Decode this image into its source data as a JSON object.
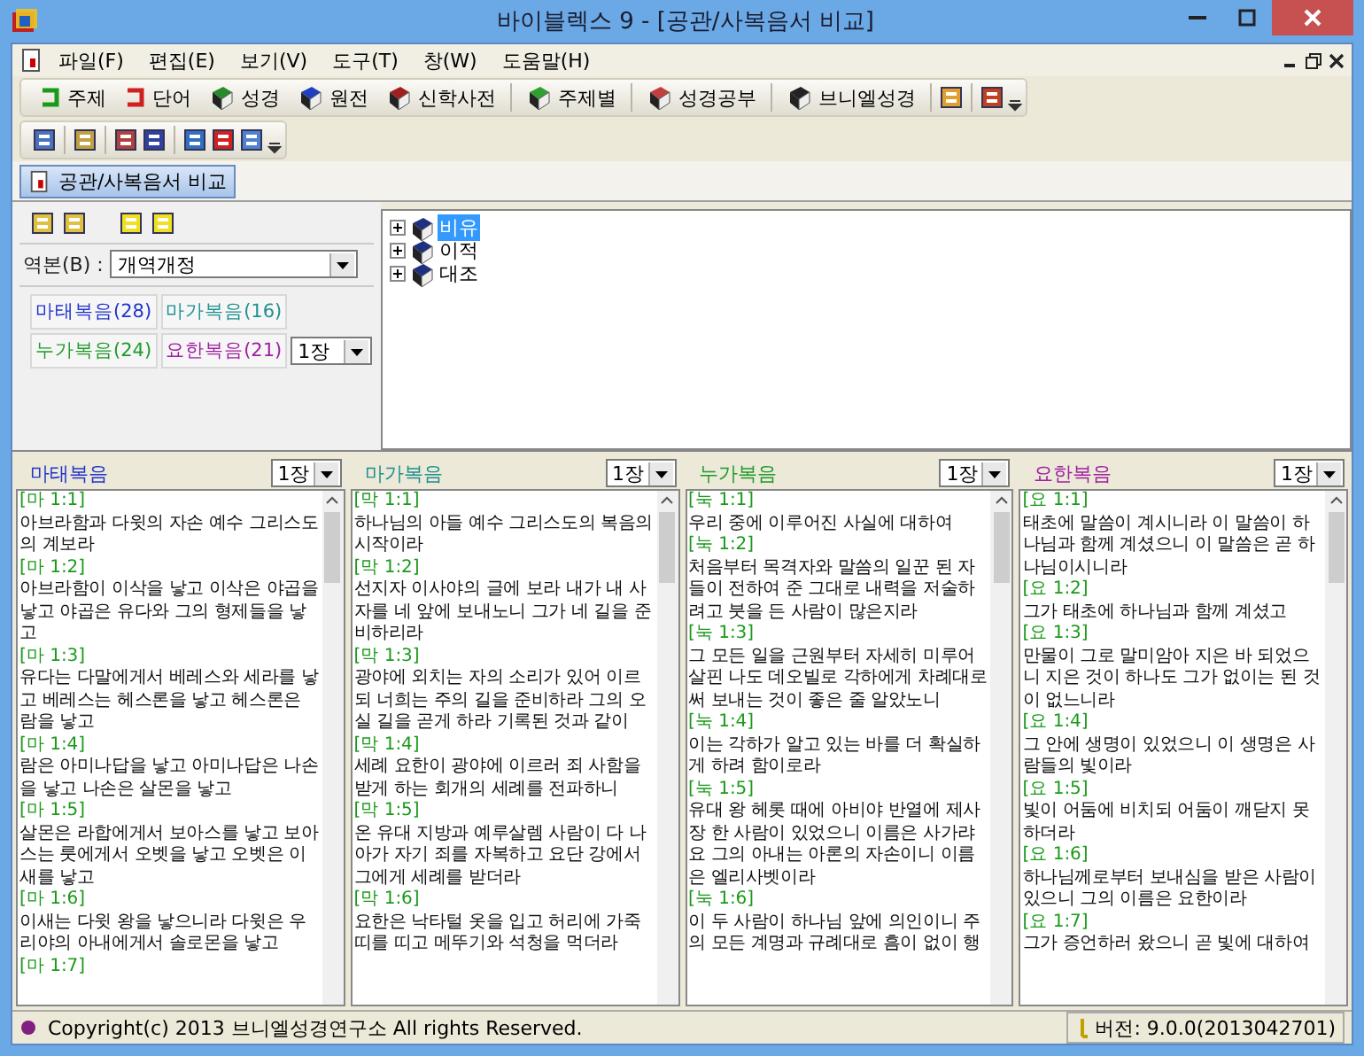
{
  "window": {
    "title": "바이블렉스 9 - [공관/사복음서 비교]"
  },
  "menu": [
    "파일(F)",
    "편집(E)",
    "보기(V)",
    "도구(T)",
    "창(W)",
    "도움말(H)"
  ],
  "toolbar": [
    {
      "label": "주제"
    },
    {
      "label": "단어"
    },
    {
      "label": "성경"
    },
    {
      "label": "원전"
    },
    {
      "label": "신학사전"
    },
    {
      "label": "주제별"
    },
    {
      "label": "성경공부"
    },
    {
      "label": "브니엘성경"
    }
  ],
  "document_tab": {
    "label": "공관/사복음서 비교",
    "selected": true
  },
  "version": {
    "label": "역본(B) :",
    "value": "개역개정"
  },
  "gospel_tabs": [
    {
      "label": "마태복음(28)",
      "color": "#2233cc"
    },
    {
      "label": "마가복음(16)",
      "color": "#1f8f8f"
    },
    {
      "label": "누가복음(24)",
      "color": "#1f9a2a"
    },
    {
      "label": "요한복음(21)",
      "color": "#a020a0"
    }
  ],
  "chapter": "1장",
  "tree": [
    {
      "label": "비유",
      "selected": true
    },
    {
      "label": "이적",
      "selected": false
    },
    {
      "label": "대조",
      "selected": false
    }
  ],
  "columns": [
    {
      "title": "마태복음",
      "color": "#2233cc",
      "chapter": "1장",
      "verses": [
        {
          "ref": "[마 1:1]",
          "text": "아브라함과 다윗의 자손 예수 그리스도의 계보라"
        },
        {
          "ref": "[마 1:2]",
          "text": "아브라함이 이삭을 낳고 이삭은 야곱을 낳고 야곱은 유다와 그의 형제들을 낳고"
        },
        {
          "ref": "[마 1:3]",
          "text": "유다는 다말에게서 베레스와 세라를 낳고 베레스는 헤스론을 낳고 헤스론은 람을 낳고"
        },
        {
          "ref": "[마 1:4]",
          "text": "람은 아미나답을 낳고 아미나답은 나손을 낳고 나손은 살몬을 낳고"
        },
        {
          "ref": "[마 1:5]",
          "text": "살몬은 라합에게서 보아스를 낳고 보아스는 룻에게서 오벳을 낳고 오벳은 이새를 낳고"
        },
        {
          "ref": "[마 1:6]",
          "text": "이새는 다윗 왕을 낳으니라 다윗은 우리야의 아내에게서 솔로몬을 낳고"
        },
        {
          "ref": "[마 1:7]"
        }
      ]
    },
    {
      "title": "마가복음",
      "color": "#1f8f8f",
      "chapter": "1장",
      "verses": [
        {
          "ref": "[막 1:1]",
          "text": "하나님의 아들 예수 그리스도의 복음의 시작이라"
        },
        {
          "ref": "[막 1:2]",
          "text": "선지자 이사야의 글에 보라 내가 내 사자를 네 앞에 보내노니 그가 네 길을 준비하리라"
        },
        {
          "ref": "[막 1:3]",
          "text": "광야에 외치는 자의 소리가 있어 이르되 너희는 주의 길을 준비하라 그의 오실 길을 곧게 하라 기록된 것과 같이"
        },
        {
          "ref": "[막 1:4]",
          "text": "세례 요한이 광야에 이르러 죄 사함을 받게 하는 회개의 세례를 전파하니"
        },
        {
          "ref": "[막 1:5]",
          "text": "온 유대 지방과 예루살렘 사람이 다 나아가 자기 죄를 자복하고 요단 강에서 그에게 세례를 받더라"
        },
        {
          "ref": "[막 1:6]",
          "text": "요한은 낙타털 옷을 입고 허리에 가죽 띠를 띠고 메뚜기와 석청을 먹더라"
        }
      ]
    },
    {
      "title": "누가복음",
      "color": "#1f9a2a",
      "chapter": "1장",
      "verses": [
        {
          "ref": "[눅 1:1]",
          "text": "우리 중에 이루어진 사실에 대하여"
        },
        {
          "ref": "[눅 1:2]",
          "text": "처음부터 목격자와 말씀의 일꾼 된 자들이 전하여 준 그대로 내력을 저술하려고 붓을 든 사람이 많은지라"
        },
        {
          "ref": "[눅 1:3]",
          "text": "그 모든 일을 근원부터 자세히 미루어 살핀 나도 데오빌로 각하에게 차례대로 써 보내는 것이 좋은 줄 알았노니"
        },
        {
          "ref": "[눅 1:4]",
          "text": "이는 각하가 알고 있는 바를 더 확실하게 하려 함이로라"
        },
        {
          "ref": "[눅 1:5]",
          "text": "유대 왕 헤롯 때에 아비야 반열에 제사장 한 사람이 있었으니 이름은 사가랴요 그의 아내는 아론의 자손이니 이름은 엘리사벳이라"
        },
        {
          "ref": "[눅 1:6]",
          "text": "이 두 사람이 하나님 앞에 의인이니 주의 모든 계명과 규례대로 흠이 없이 행"
        }
      ]
    },
    {
      "title": "요한복음",
      "color": "#a020a0",
      "chapter": "1장",
      "verses": [
        {
          "ref": "[요 1:1]",
          "text": "태초에 말씀이 계시니라 이 말씀이 하나님과 함께 계셨으니 이 말씀은 곧 하나님이시니라"
        },
        {
          "ref": "[요 1:2]",
          "text": "그가 태초에 하나님과 함께 계셨고"
        },
        {
          "ref": "[요 1:3]",
          "text": "만물이 그로 말미암아 지은 바 되었으니 지은 것이 하나도 그가 없이는 된 것이 없느니라"
        },
        {
          "ref": "[요 1:4]",
          "text": "그 안에 생명이 있었으니 이 생명은 사람들의 빛이라"
        },
        {
          "ref": "[요 1:5]",
          "text": "빛이 어둠에 비치되 어둠이 깨닫지 못하더라"
        },
        {
          "ref": "[요 1:6]",
          "text": "하나님께로부터 보내심을 받은 사람이 있으니 그의 이름은 요한이라"
        },
        {
          "ref": "[요 1:7]",
          "text": "그가 증언하러 왔으니 곧 빛에 대하여"
        }
      ]
    }
  ],
  "status_bar": {
    "copyright": "Copyright(c) 2013 브니엘성경연구소 All rights Reserved.",
    "version": "버전: 9.0.0(2013042701)"
  }
}
